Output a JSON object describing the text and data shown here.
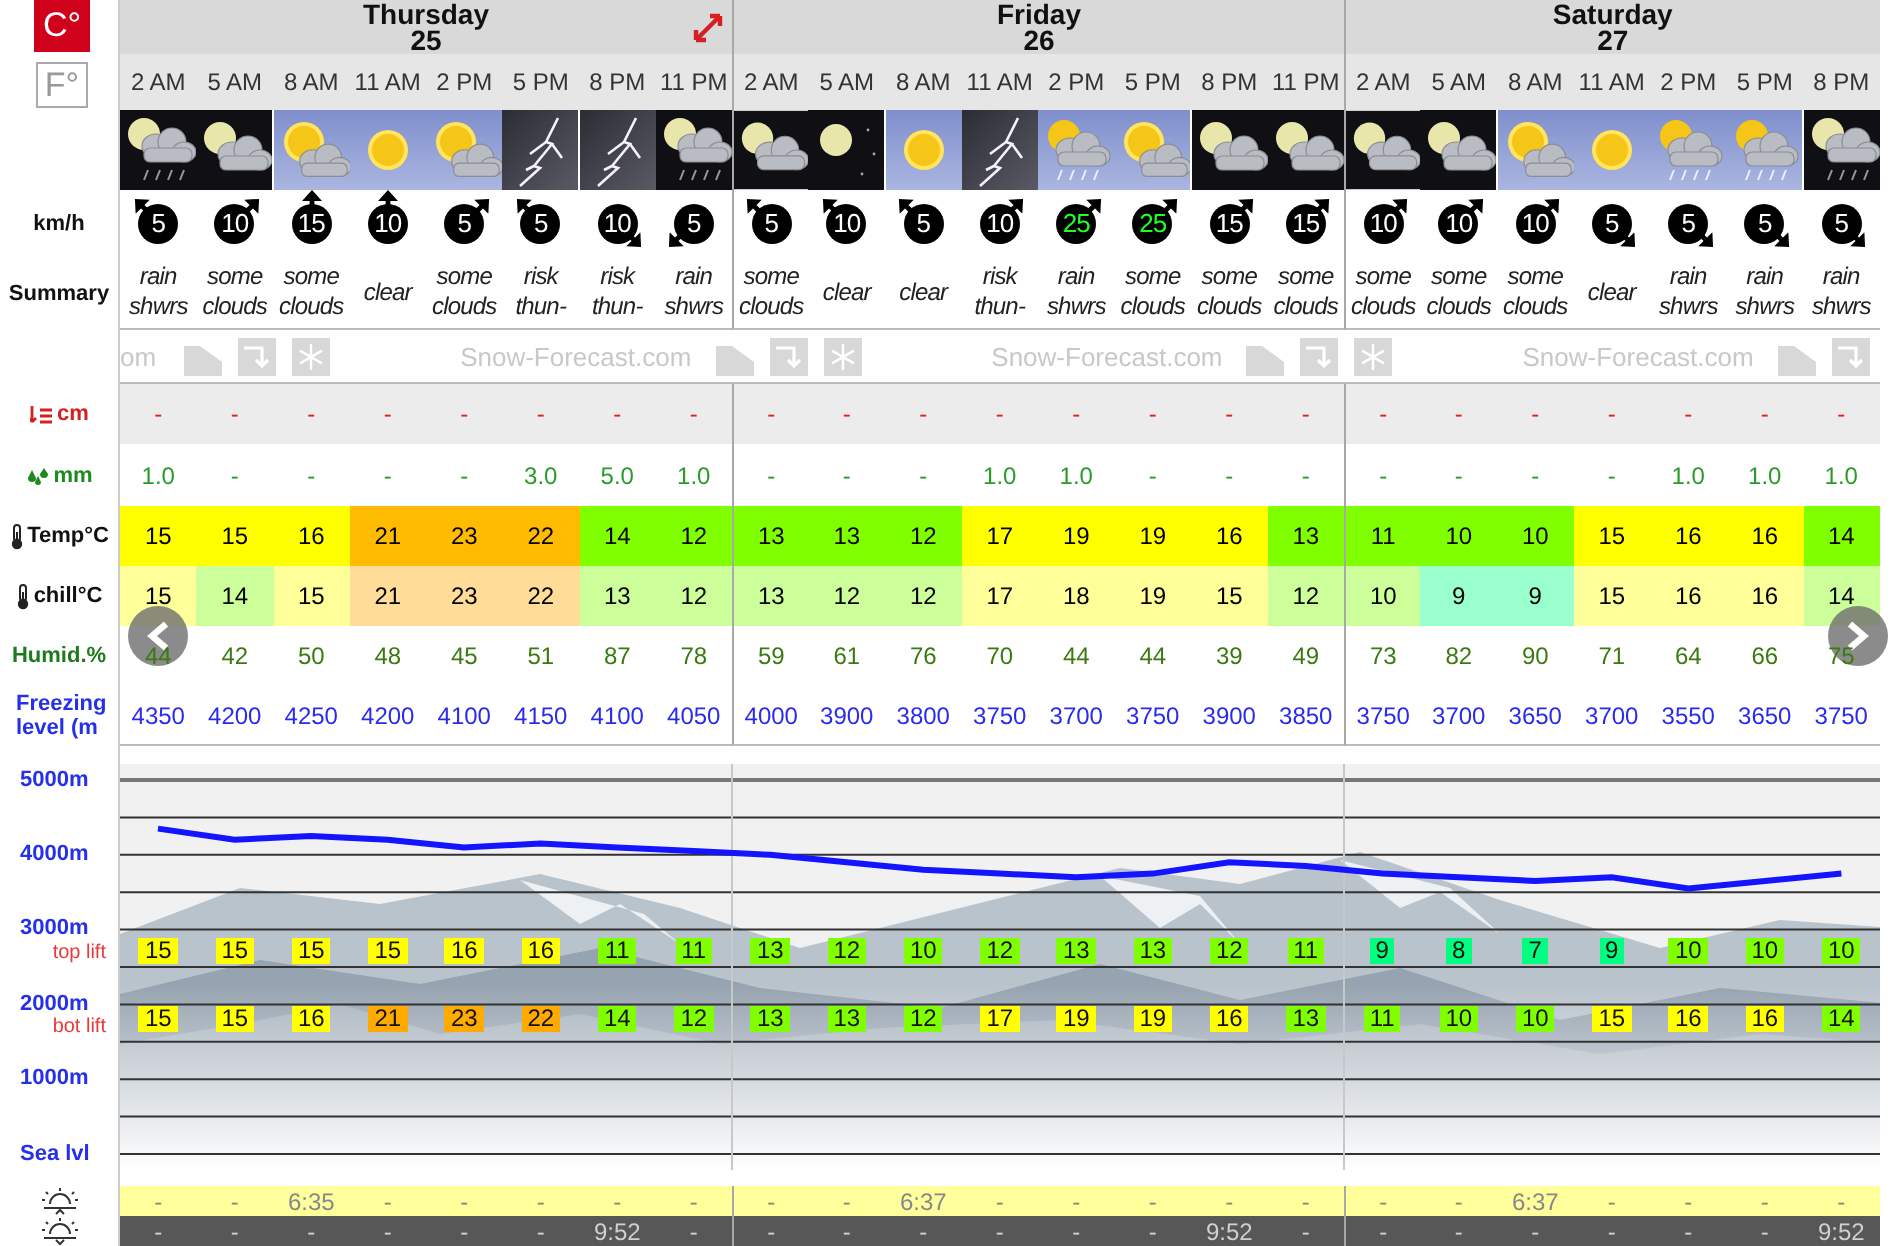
{
  "units": [
    {
      "label": "C°",
      "selected": true
    },
    {
      "label": "F°",
      "selected": false
    }
  ],
  "row_labels": {
    "wind": "km/h",
    "summary": "Summary",
    "snow": "cm",
    "rain": "mm",
    "temp": "Temp°C",
    "chill": "chill°C",
    "humidity": "Humid.%",
    "freezing": "Freezing level (m"
  },
  "banner": {
    "lead": "om",
    "brand": [
      "Snow-Forecast.com",
      "Snow-Forecast.com",
      "Snow-Forecast.com"
    ]
  },
  "days": [
    {
      "name": "Thursday",
      "date": "25",
      "columns": [
        {
          "time": "2 AM",
          "kind": "moon-cloud-rain",
          "wind": {
            "speed": "5",
            "kind": "nw",
            "strong": false
          },
          "summary": "rain shwrs",
          "snow": "-",
          "rain": "1.0",
          "temp": {
            "value": "15",
            "color": "#ffff00"
          },
          "chill": {
            "value": "15",
            "color": "#ffff99"
          },
          "humidity": "44",
          "freezing": "4350",
          "top_lift": {
            "value": "15",
            "color": "#ffff00"
          },
          "bot_lift": {
            "value": "15",
            "color": "#ffff00"
          },
          "sunrise": "-",
          "sunset": "-"
        },
        {
          "time": "5 AM",
          "kind": "moon-cloud",
          "wind": {
            "speed": "10",
            "kind": "ne",
            "strong": false
          },
          "summary": "some clouds",
          "snow": "-",
          "rain": "-",
          "temp": {
            "value": "15",
            "color": "#ffff00"
          },
          "chill": {
            "value": "14",
            "color": "#ccff99"
          },
          "humidity": "42",
          "freezing": "4200",
          "top_lift": {
            "value": "15",
            "color": "#ffff00"
          },
          "bot_lift": {
            "value": "15",
            "color": "#ffff00"
          },
          "sunrise": "-",
          "sunset": "-"
        },
        {
          "time": "8 AM",
          "kind": "sun-cloud",
          "wind": {
            "speed": "15",
            "kind": "n",
            "strong": false
          },
          "summary": "some clouds",
          "snow": "-",
          "rain": "-",
          "temp": {
            "value": "16",
            "color": "#ffff00"
          },
          "chill": {
            "value": "15",
            "color": "#ffff99"
          },
          "humidity": "50",
          "freezing": "4250",
          "top_lift": {
            "value": "15",
            "color": "#ffff00"
          },
          "bot_lift": {
            "value": "16",
            "color": "#ffff00"
          },
          "sunrise": "6:35",
          "sunset": "-"
        },
        {
          "time": "11 AM",
          "kind": "sun",
          "wind": {
            "speed": "10",
            "kind": "n",
            "strong": false
          },
          "summary": "clear",
          "snow": "-",
          "rain": "-",
          "temp": {
            "value": "21",
            "color": "#ffbb00"
          },
          "chill": {
            "value": "21",
            "color": "#ffdd99"
          },
          "humidity": "48",
          "freezing": "4200",
          "top_lift": {
            "value": "15",
            "color": "#ffff00"
          },
          "bot_lift": {
            "value": "21",
            "color": "#ffaa00"
          },
          "sunrise": "-",
          "sunset": "-"
        },
        {
          "time": "2 PM",
          "kind": "sun-cloud",
          "wind": {
            "speed": "5",
            "kind": "ne",
            "strong": false
          },
          "summary": "some clouds",
          "snow": "-",
          "rain": "-",
          "temp": {
            "value": "23",
            "color": "#ffbb00"
          },
          "chill": {
            "value": "23",
            "color": "#ffdd99"
          },
          "humidity": "45",
          "freezing": "4100",
          "top_lift": {
            "value": "16",
            "color": "#ffff00"
          },
          "bot_lift": {
            "value": "23",
            "color": "#ffaa00"
          },
          "sunrise": "-",
          "sunset": "-"
        },
        {
          "time": "5 PM",
          "kind": "thunder",
          "wind": {
            "speed": "5",
            "kind": "nw",
            "strong": false
          },
          "summary": "risk thun-",
          "snow": "-",
          "rain": "3.0",
          "temp": {
            "value": "22",
            "color": "#ffbb00"
          },
          "chill": {
            "value": "22",
            "color": "#ffdd99"
          },
          "humidity": "51",
          "freezing": "4150",
          "top_lift": {
            "value": "16",
            "color": "#ffff00"
          },
          "bot_lift": {
            "value": "22",
            "color": "#ffaa00"
          },
          "sunrise": "-",
          "sunset": "-"
        },
        {
          "time": "8 PM",
          "kind": "thunder",
          "wind": {
            "speed": "10",
            "kind": "se",
            "strong": false
          },
          "summary": "risk thun-",
          "snow": "-",
          "rain": "5.0",
          "temp": {
            "value": "14",
            "color": "#80ff00"
          },
          "chill": {
            "value": "13",
            "color": "#ccff99"
          },
          "humidity": "87",
          "freezing": "4100",
          "top_lift": {
            "value": "11",
            "color": "#80ff00"
          },
          "bot_lift": {
            "value": "14",
            "color": "#80ff00"
          },
          "sunrise": "-",
          "sunset": "9:52"
        },
        {
          "time": "11 PM",
          "kind": "moon-cloud-rain",
          "wind": {
            "speed": "5",
            "kind": "sw",
            "strong": false
          },
          "summary": "rain shwrs",
          "snow": "-",
          "rain": "1.0",
          "temp": {
            "value": "12",
            "color": "#80ff00"
          },
          "chill": {
            "value": "12",
            "color": "#ccff99"
          },
          "humidity": "78",
          "freezing": "4050",
          "top_lift": {
            "value": "11",
            "color": "#80ff00"
          },
          "bot_lift": {
            "value": "12",
            "color": "#80ff00"
          },
          "sunrise": "-",
          "sunset": "-"
        }
      ]
    },
    {
      "name": "Friday",
      "date": "26",
      "columns": [
        {
          "time": "2 AM",
          "kind": "moon-cloud",
          "wind": {
            "speed": "5",
            "kind": "nw",
            "strong": false
          },
          "summary": "some clouds",
          "snow": "-",
          "rain": "-",
          "temp": {
            "value": "13",
            "color": "#80ff00"
          },
          "chill": {
            "value": "13",
            "color": "#ccff99"
          },
          "humidity": "59",
          "freezing": "4000",
          "top_lift": {
            "value": "13",
            "color": "#80ff00"
          },
          "bot_lift": {
            "value": "13",
            "color": "#80ff00"
          },
          "sunrise": "-",
          "sunset": "-"
        },
        {
          "time": "5 AM",
          "kind": "moon",
          "wind": {
            "speed": "10",
            "kind": "nw",
            "strong": false
          },
          "summary": "clear",
          "snow": "-",
          "rain": "-",
          "temp": {
            "value": "13",
            "color": "#80ff00"
          },
          "chill": {
            "value": "12",
            "color": "#ccff99"
          },
          "humidity": "61",
          "freezing": "3900",
          "top_lift": {
            "value": "12",
            "color": "#80ff00"
          },
          "bot_lift": {
            "value": "13",
            "color": "#80ff00"
          },
          "sunrise": "-",
          "sunset": "-"
        },
        {
          "time": "8 AM",
          "kind": "sun",
          "wind": {
            "speed": "5",
            "kind": "nw",
            "strong": false
          },
          "summary": "clear",
          "snow": "-",
          "rain": "-",
          "temp": {
            "value": "12",
            "color": "#80ff00"
          },
          "chill": {
            "value": "12",
            "color": "#ccff99"
          },
          "humidity": "76",
          "freezing": "3800",
          "top_lift": {
            "value": "10",
            "color": "#80ff00"
          },
          "bot_lift": {
            "value": "12",
            "color": "#80ff00"
          },
          "sunrise": "6:37",
          "sunset": "-"
        },
        {
          "time": "11 AM",
          "kind": "thunder",
          "wind": {
            "speed": "10",
            "kind": "ne",
            "strong": false
          },
          "summary": "risk thun-",
          "snow": "-",
          "rain": "1.0",
          "temp": {
            "value": "17",
            "color": "#ffff00"
          },
          "chill": {
            "value": "17",
            "color": "#ffff99"
          },
          "humidity": "70",
          "freezing": "3750",
          "top_lift": {
            "value": "12",
            "color": "#80ff00"
          },
          "bot_lift": {
            "value": "17",
            "color": "#ffff00"
          },
          "sunrise": "-",
          "sunset": "-"
        },
        {
          "time": "2 PM",
          "kind": "sun-cloud-rain",
          "wind": {
            "speed": "25",
            "kind": "ne",
            "strong": true
          },
          "summary": "rain shwrs",
          "snow": "-",
          "rain": "1.0",
          "temp": {
            "value": "19",
            "color": "#ffff00"
          },
          "chill": {
            "value": "18",
            "color": "#ffff99"
          },
          "humidity": "44",
          "freezing": "3700",
          "top_lift": {
            "value": "13",
            "color": "#80ff00"
          },
          "bot_lift": {
            "value": "19",
            "color": "#ffff00"
          },
          "sunrise": "-",
          "sunset": "-"
        },
        {
          "time": "5 PM",
          "kind": "sun-cloud",
          "wind": {
            "speed": "25",
            "kind": "ne",
            "strong": true
          },
          "summary": "some clouds",
          "snow": "-",
          "rain": "-",
          "temp": {
            "value": "19",
            "color": "#ffff00"
          },
          "chill": {
            "value": "19",
            "color": "#ffff99"
          },
          "humidity": "44",
          "freezing": "3750",
          "top_lift": {
            "value": "13",
            "color": "#80ff00"
          },
          "bot_lift": {
            "value": "19",
            "color": "#ffff00"
          },
          "sunrise": "-",
          "sunset": "-"
        },
        {
          "time": "8 PM",
          "kind": "moon-cloud",
          "wind": {
            "speed": "15",
            "kind": "ne",
            "strong": false
          },
          "summary": "some clouds",
          "snow": "-",
          "rain": "-",
          "temp": {
            "value": "16",
            "color": "#ffff00"
          },
          "chill": {
            "value": "15",
            "color": "#ffff99"
          },
          "humidity": "39",
          "freezing": "3900",
          "top_lift": {
            "value": "12",
            "color": "#80ff00"
          },
          "bot_lift": {
            "value": "16",
            "color": "#ffff00"
          },
          "sunrise": "-",
          "sunset": "9:52"
        },
        {
          "time": "11 PM",
          "kind": "moon-cloud",
          "wind": {
            "speed": "15",
            "kind": "ne",
            "strong": false
          },
          "summary": "some clouds",
          "snow": "-",
          "rain": "-",
          "temp": {
            "value": "13",
            "color": "#80ff00"
          },
          "chill": {
            "value": "12",
            "color": "#ccff99"
          },
          "humidity": "49",
          "freezing": "3850",
          "top_lift": {
            "value": "11",
            "color": "#80ff00"
          },
          "bot_lift": {
            "value": "13",
            "color": "#80ff00"
          },
          "sunrise": "-",
          "sunset": "-"
        }
      ]
    },
    {
      "name": "Saturday",
      "date": "27",
      "columns": [
        {
          "time": "2 AM",
          "kind": "moon-cloud",
          "wind": {
            "speed": "10",
            "kind": "ne",
            "strong": false
          },
          "summary": "some clouds",
          "snow": "-",
          "rain": "-",
          "temp": {
            "value": "11",
            "color": "#80ff00"
          },
          "chill": {
            "value": "10",
            "color": "#ccff99"
          },
          "humidity": "73",
          "freezing": "3750",
          "top_lift": {
            "value": "9",
            "color": "#00ff80"
          },
          "bot_lift": {
            "value": "11",
            "color": "#80ff00"
          },
          "sunrise": "-",
          "sunset": "-"
        },
        {
          "time": "5 AM",
          "kind": "moon-cloud",
          "wind": {
            "speed": "10",
            "kind": "ne",
            "strong": false
          },
          "summary": "some clouds",
          "snow": "-",
          "rain": "-",
          "temp": {
            "value": "10",
            "color": "#80ff00"
          },
          "chill": {
            "value": "9",
            "color": "#99ffcc"
          },
          "humidity": "82",
          "freezing": "3700",
          "top_lift": {
            "value": "8",
            "color": "#00ff80"
          },
          "bot_lift": {
            "value": "10",
            "color": "#80ff00"
          },
          "sunrise": "-",
          "sunset": "-"
        },
        {
          "time": "8 AM",
          "kind": "sun-cloud",
          "wind": {
            "speed": "10",
            "kind": "ne",
            "strong": false
          },
          "summary": "some clouds",
          "snow": "-",
          "rain": "-",
          "temp": {
            "value": "10",
            "color": "#80ff00"
          },
          "chill": {
            "value": "9",
            "color": "#99ffcc"
          },
          "humidity": "90",
          "freezing": "3650",
          "top_lift": {
            "value": "7",
            "color": "#00ff80"
          },
          "bot_lift": {
            "value": "10",
            "color": "#80ff00"
          },
          "sunrise": "6:37",
          "sunset": "-"
        },
        {
          "time": "11 AM",
          "kind": "sun",
          "wind": {
            "speed": "5",
            "kind": "se",
            "strong": false
          },
          "summary": "clear",
          "snow": "-",
          "rain": "-",
          "temp": {
            "value": "15",
            "color": "#ffff00"
          },
          "chill": {
            "value": "15",
            "color": "#ffff99"
          },
          "humidity": "71",
          "freezing": "3700",
          "top_lift": {
            "value": "9",
            "color": "#00ff80"
          },
          "bot_lift": {
            "value": "15",
            "color": "#ffff00"
          },
          "sunrise": "-",
          "sunset": "-"
        },
        {
          "time": "2 PM",
          "kind": "sun-cloud-rain",
          "wind": {
            "speed": "5",
            "kind": "se",
            "strong": false
          },
          "summary": "rain shwrs",
          "snow": "-",
          "rain": "1.0",
          "temp": {
            "value": "16",
            "color": "#ffff00"
          },
          "chill": {
            "value": "16",
            "color": "#ffff99"
          },
          "humidity": "64",
          "freezing": "3550",
          "top_lift": {
            "value": "10",
            "color": "#80ff00"
          },
          "bot_lift": {
            "value": "16",
            "color": "#ffff00"
          },
          "sunrise": "-",
          "sunset": "-"
        },
        {
          "time": "5 PM",
          "kind": "sun-cloud-rain",
          "wind": {
            "speed": "5",
            "kind": "se",
            "strong": false
          },
          "summary": "rain shwrs",
          "snow": "-",
          "rain": "1.0",
          "temp": {
            "value": "16",
            "color": "#ffff00"
          },
          "chill": {
            "value": "16",
            "color": "#ffff99"
          },
          "humidity": "66",
          "freezing": "3650",
          "top_lift": {
            "value": "10",
            "color": "#80ff00"
          },
          "bot_lift": {
            "value": "16",
            "color": "#ffff00"
          },
          "sunrise": "-",
          "sunset": "-"
        },
        {
          "time": "8 PM",
          "kind": "moon-cloud-rain",
          "wind": {
            "speed": "5",
            "kind": "se",
            "strong": false
          },
          "summary": "rain shwrs",
          "snow": "-",
          "rain": "1.0",
          "temp": {
            "value": "14",
            "color": "#80ff00"
          },
          "chill": {
            "value": "14",
            "color": "#ccff99"
          },
          "humidity": "75",
          "freezing": "3750",
          "top_lift": {
            "value": "10",
            "color": "#80ff00"
          },
          "bot_lift": {
            "value": "14",
            "color": "#80ff00"
          },
          "sunrise": "-",
          "sunset": "9:52"
        }
      ]
    }
  ],
  "altitude_chart": {
    "chart_data": {
      "type": "line",
      "ylim": [
        0,
        5000
      ],
      "grid": true,
      "yticks": [
        {
          "value": 5000,
          "label": "5000m"
        },
        {
          "value": 4000,
          "label": "4000m"
        },
        {
          "value": 3000,
          "label": "3000m"
        },
        {
          "value": 2000,
          "label": "2000m"
        },
        {
          "value": 1000,
          "label": "1000m"
        },
        {
          "value": 0,
          "label": "Sea lvl"
        }
      ],
      "series": [
        {
          "color": "#1414ff",
          "values": [
            4350,
            4200,
            4250,
            4200,
            4100,
            4150,
            4100,
            4050,
            4000,
            3900,
            3800,
            3750,
            3700,
            3750,
            3900,
            3850,
            3750,
            3700,
            3650,
            3700,
            3550,
            3650,
            3750
          ]
        }
      ]
    }
  },
  "lift_labels": {
    "top": "top lift",
    "bot": "bot lift"
  }
}
